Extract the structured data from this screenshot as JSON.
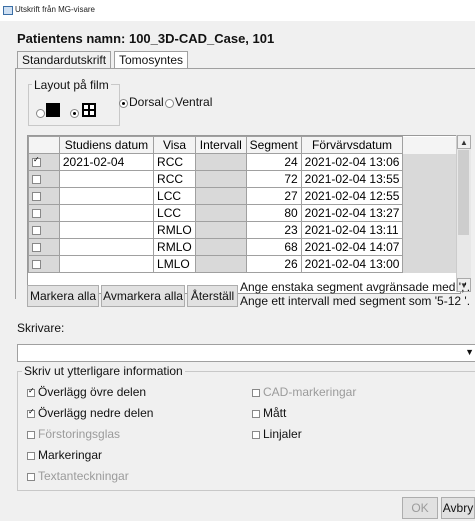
{
  "window": {
    "title": "Utskrift från MG-visare"
  },
  "patient": {
    "label": "Patientens namn: 100_3D-CAD_Case, 101"
  },
  "tabs": [
    {
      "label": "Standardutskrift",
      "active": false
    },
    {
      "label": "Tomosyntes",
      "active": true
    }
  ],
  "layout": {
    "legend": "Layout på film",
    "options": [
      {
        "selected": false,
        "icon": "single-layout-icon"
      },
      {
        "selected": true,
        "icon": "quad-layout-icon"
      }
    ],
    "orientation": [
      {
        "label": "Dorsal",
        "selected": true
      },
      {
        "label": "Ventral",
        "selected": false
      }
    ]
  },
  "table": {
    "headers": [
      "",
      "Studiens datum",
      "Visa",
      "Intervall",
      "Segment",
      "Förvärvsdatum"
    ],
    "rows": [
      {
        "checked": true,
        "date": "2021-02-04",
        "view": "RCC",
        "interval": "",
        "segment": "24",
        "acq": "2021-02-04 13:06"
      },
      {
        "checked": false,
        "date": "",
        "view": "RCC",
        "interval": "",
        "segment": "72",
        "acq": "2021-02-04 13:55"
      },
      {
        "checked": false,
        "date": "",
        "view": "LCC",
        "interval": "",
        "segment": "27",
        "acq": "2021-02-04 12:55"
      },
      {
        "checked": false,
        "date": "",
        "view": "LCC",
        "interval": "",
        "segment": "80",
        "acq": "2021-02-04 13:27"
      },
      {
        "checked": false,
        "date": "",
        "view": "RMLO",
        "interval": "",
        "segment": "23",
        "acq": "2021-02-04 13:11"
      },
      {
        "checked": false,
        "date": "",
        "view": "RMLO",
        "interval": "",
        "segment": "68",
        "acq": "2021-02-04 14:07"
      },
      {
        "checked": false,
        "date": "",
        "view": "LMLO",
        "interval": "",
        "segment": "26",
        "acq": "2021-02-04 13:00"
      }
    ]
  },
  "actions": {
    "mark_all": "Markera alla",
    "unmark_all": "Avmarkera alla",
    "reset": "Återställ"
  },
  "hints": {
    "line1": "Ange enstaka segment avgränsade med ','.",
    "line2": "Ange ett intervall med segment som '5-12 '."
  },
  "printer": {
    "label": "Skrivare:",
    "value": ""
  },
  "extra": {
    "legend": "Skriv ut ytterligare information",
    "left": [
      {
        "label": "Överlägg övre delen",
        "checked": true,
        "enabled": true
      },
      {
        "label": "Överlägg nedre delen",
        "checked": true,
        "enabled": true
      },
      {
        "label": "Förstoringsglas",
        "checked": false,
        "enabled": false
      },
      {
        "label": "Markeringar",
        "checked": false,
        "enabled": true
      },
      {
        "label": "Textanteckningar",
        "checked": false,
        "enabled": false
      }
    ],
    "right": [
      {
        "label": "CAD-markeringar",
        "checked": false,
        "enabled": false
      },
      {
        "label": "Mått",
        "checked": false,
        "enabled": true
      },
      {
        "label": "Linjaler",
        "checked": false,
        "enabled": true
      }
    ]
  },
  "footer": {
    "ok": "OK",
    "cancel": "Avbry"
  }
}
